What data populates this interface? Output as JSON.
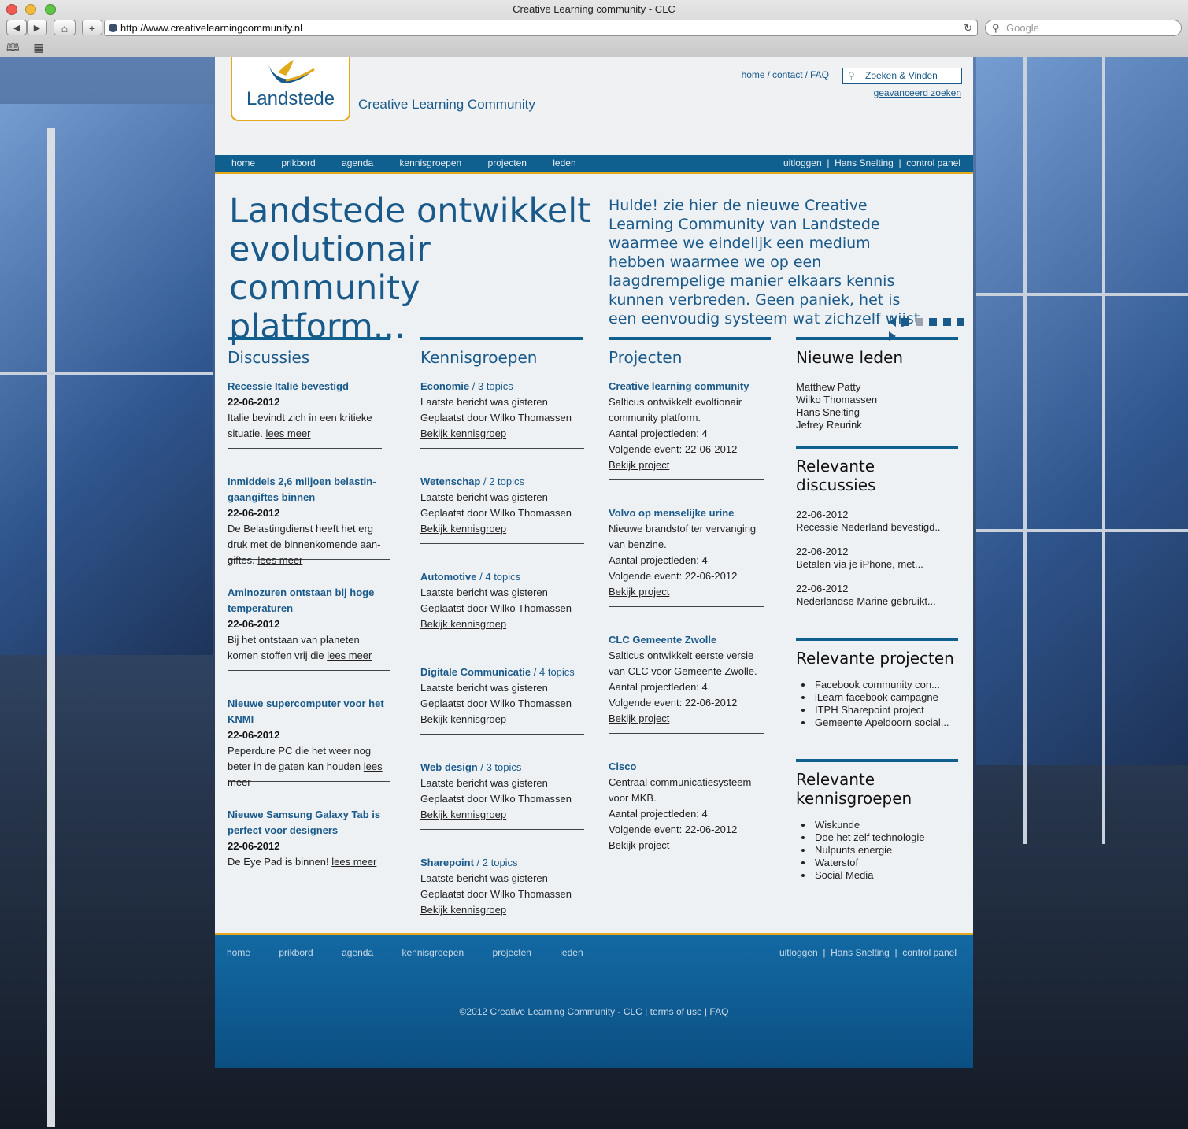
{
  "browser": {
    "window_title": "Creative Learning community - CLC",
    "url": "http://www.creativelearningcommunity.nl",
    "search_placeholder": "Google",
    "back_label": "◀",
    "forward_label": "▶",
    "home_label": "⌂",
    "add_label": "+",
    "reload_label": "↻",
    "bookmarks_icon": "📖",
    "apps_icon": "▦"
  },
  "header": {
    "logo_text": "Landstede",
    "tagline": "Creative Learning Community",
    "top_links": [
      "home",
      "contact",
      "FAQ"
    ],
    "search_placeholder": "Zoeken & Vinden",
    "advanced_search": "geavanceerd zoeken"
  },
  "nav": {
    "left": [
      "home",
      "prikbord",
      "agenda",
      "kennisgroepen",
      "projecten",
      "leden"
    ],
    "right": [
      "uitloggen",
      "Hans Snelting",
      "control panel"
    ]
  },
  "hero": {
    "title": "Landstede ontwikkelt evolutionair community platform...",
    "text": "Hulde! zie hier de nieuwe Creative Learning Community  van Landstede waarmee we eindelijk een medium hebben waarmee we op een laagdrempelige manier elkaars kennis kunnen verbreden. Geen paniek, het is een eenvoudig systeem wat zichzelf wijst.",
    "carousel_slides": 5,
    "carousel_active": 2
  },
  "discussies": {
    "heading": "Discussies",
    "items": [
      {
        "title": "Recessie Italië bevestigd",
        "date": "22-06-2012",
        "text": "Italie bevindt zich in een kritieke situatie.",
        "link": "lees meer"
      },
      {
        "title": "Inmiddels 2,6 miljoen belastin-gaangiftes binnen",
        "date": "22-06-2012",
        "text": "De Belastingdienst heeft het erg druk met de binnenkomende aan-giftes.",
        "link": "lees meer"
      },
      {
        "title": "Aminozuren ontstaan bij hoge temperaturen",
        "date": "22-06-2012",
        "text": "Bij het ontstaan van planeten komen stoffen vrij die",
        "link": "lees meer"
      },
      {
        "title": "Nieuwe supercomputer voor het KNMI",
        "date": "22-06-2012",
        "text": "Peperdure PC die het weer nog beter in de gaten kan houden",
        "link": "lees meer"
      },
      {
        "title": "Nieuwe Samsung Galaxy Tab is perfect voor designers",
        "date": "22-06-2012",
        "text": "De Eye Pad is binnen!",
        "link": "lees meer"
      }
    ]
  },
  "kennisgroepen": {
    "heading": "Kennisgroepen",
    "items": [
      {
        "title": "Economie",
        "count": "/ 3 topics",
        "line1": "Laatste bericht was gisteren",
        "line2": "Geplaatst door Wilko Thomassen",
        "link": "Bekijk kennisgroep"
      },
      {
        "title": "Wetenschap",
        "count": "/ 2 topics",
        "line1": "Laatste bericht was gisteren",
        "line2": "Geplaatst door Wilko Thomassen",
        "link": "Bekijk kennisgroep"
      },
      {
        "title": "Automotive",
        "count": "/ 4 topics",
        "line1": "Laatste bericht was gisteren",
        "line2": "Geplaatst door Wilko Thomassen",
        "link": "Bekijk kennisgroep"
      },
      {
        "title": "Digitale Communicatie",
        "count": "/ 4 topics",
        "line1": "Laatste bericht was gisteren",
        "line2": "Geplaatst door Wilko Thomassen",
        "link": "Bekijk kennisgroep"
      },
      {
        "title": "Web design",
        "count": "/ 3 topics",
        "line1": "Laatste bericht was gisteren",
        "line2": "Geplaatst door Wilko Thomassen",
        "link": "Bekijk kennisgroep"
      },
      {
        "title": "Sharepoint",
        "count": "/ 2 topics",
        "line1": "Laatste bericht was gisteren",
        "line2": "Geplaatst door Wilko Thomassen",
        "link": "Bekijk kennisgroep"
      }
    ]
  },
  "projecten": {
    "heading": "Projecten",
    "items": [
      {
        "title": "Creative learning community",
        "text": "Salticus ontwikkelt evoltionair community platform.",
        "members": "Aantal projectleden: 4",
        "event": "Volgende event: 22-06-2012",
        "link": "Bekijk project"
      },
      {
        "title": "Volvo op menselijke urine",
        "text": "Nieuwe brandstof ter vervanging van benzine.",
        "members": "Aantal projectleden: 4",
        "event": "Volgende event: 22-06-2012",
        "link": "Bekijk project"
      },
      {
        "title": "CLC Gemeente Zwolle",
        "text": "Salticus ontwikkelt eerste versie van CLC voor Gemeente Zwolle.",
        "members": "Aantal projectleden: 4",
        "event": "Volgende event: 22-06-2012",
        "link": "Bekijk project"
      },
      {
        "title": "Cisco",
        "text": "Centraal communicatiesysteem voor MKB.",
        "members": "Aantal projectleden: 4",
        "event": "Volgende event: 22-06-2012",
        "link": "Bekijk project"
      }
    ]
  },
  "sidebar": {
    "new_members_heading": "Nieuwe leden",
    "new_members": [
      "Matthew Patty",
      "Wilko Thomassen",
      "Hans Snelting",
      "Jefrey Reurink"
    ],
    "rel_discussions_heading": "Relevante discussies",
    "rel_discussions": [
      {
        "date": "22-06-2012",
        "title": "Recessie Nederland bevestigd.."
      },
      {
        "date": "22-06-2012",
        "title": "Betalen via je iPhone, met..."
      },
      {
        "date": "22-06-2012",
        "title": "Nederlandse Marine gebruikt..."
      }
    ],
    "rel_projects_heading": "Relevante projecten",
    "rel_projects": [
      "Facebook community con...",
      "iLearn facebook campagne",
      "ITPH Sharepoint project",
      "Gemeente Apeldoorn social..."
    ],
    "rel_groups_heading": "Relevante kennisgroepen",
    "rel_groups": [
      "Wiskunde",
      "Doe het zelf technologie",
      "Nulpunts energie",
      "Waterstof",
      "Social Media"
    ]
  },
  "footer": {
    "copyright": "©2012 Creative Learning Community - CLC  |  terms of use | FAQ"
  },
  "colors": {
    "brand_blue": "#0f5f8f",
    "accent_gold": "#e3a91a",
    "text_blue": "#1a5a8a"
  }
}
